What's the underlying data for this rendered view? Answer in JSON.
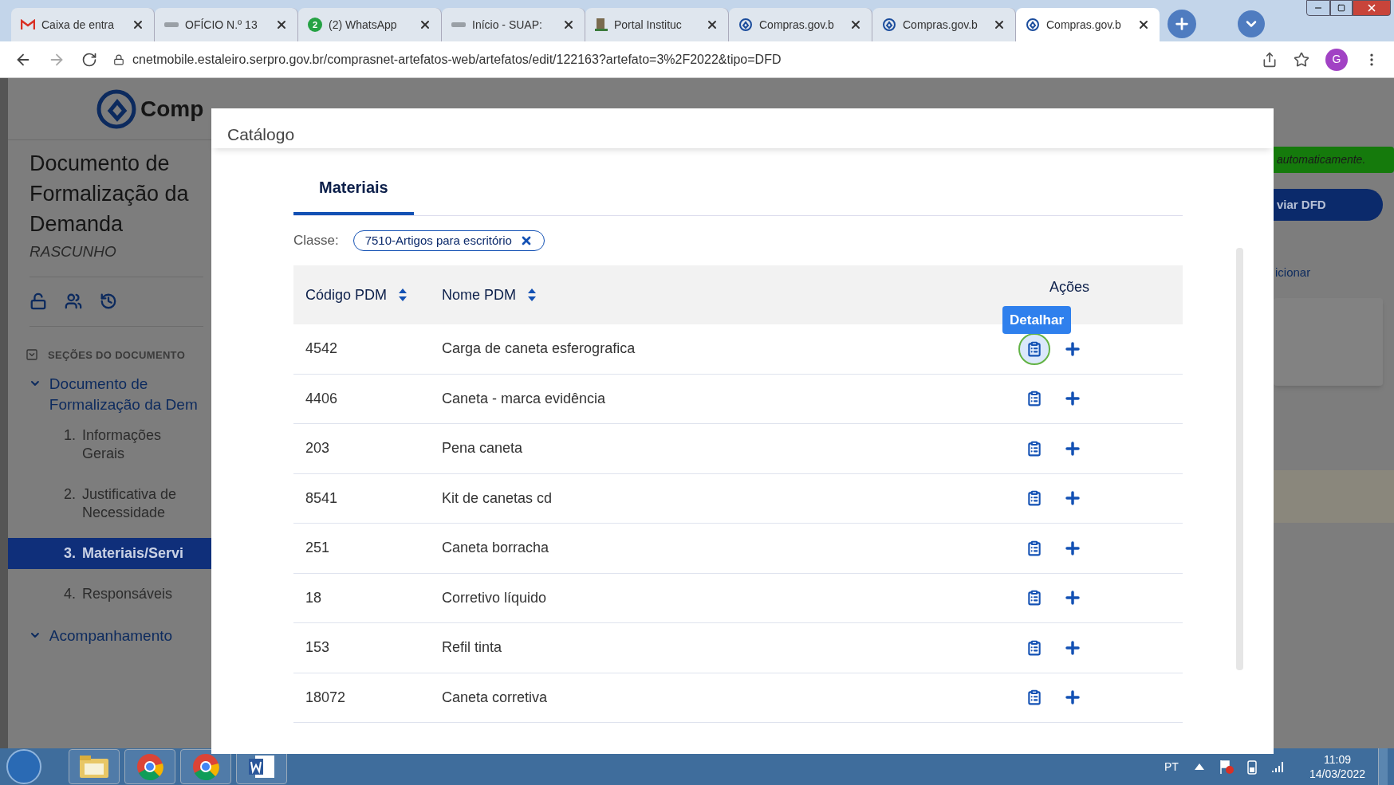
{
  "browser": {
    "tabs": [
      {
        "kind": "gmail",
        "title": "Caixa de entra",
        "selected": false
      },
      {
        "kind": "suap",
        "title": "OFÍCIO N.º 13",
        "selected": false
      },
      {
        "kind": "whatsapp",
        "badge": "2",
        "title": "(2) WhatsApp",
        "selected": false
      },
      {
        "kind": "suap",
        "title": "Início - SUAP:",
        "selected": false
      },
      {
        "kind": "portal",
        "title": "Portal Instituc",
        "selected": false
      },
      {
        "kind": "compras",
        "title": "Compras.gov.b",
        "selected": false
      },
      {
        "kind": "compras",
        "title": "Compras.gov.b",
        "selected": false
      },
      {
        "kind": "compras",
        "title": "Compras.gov.b",
        "selected": true
      }
    ],
    "url": "cnetmobile.estaleiro.serpro.gov.br/comprasnet-artefatos-web/artefatos/edit/122163?artefato=3%2F2022&tipo=DFD",
    "profile": "G"
  },
  "page": {
    "logo_text": "Comp",
    "document_title": "Documento de Formalização da Demanda",
    "status": "RASCUNHO",
    "sections_title": "SEÇÕES DO DOCUMENTO",
    "nav": [
      {
        "label": "Documento de Formalização da Dem",
        "expanded": true,
        "children": [
          {
            "number": "1.",
            "label": "Informações Gerais",
            "selected": false
          },
          {
            "number": "2.",
            "label": "Justificativa de Necessidade",
            "selected": false
          },
          {
            "number": "3.",
            "label": "Materiais/Servi",
            "selected": true
          },
          {
            "number": "4.",
            "label": "Responsáveis",
            "selected": false
          }
        ]
      },
      {
        "label": "Acompanhamento",
        "expanded": true
      }
    ],
    "save_notice": "automaticamente.",
    "send_button": "viar DFD",
    "add_link": "icionar"
  },
  "modal": {
    "title": "Catálogo",
    "tabs": [
      {
        "label": "Materiais",
        "selected": true
      }
    ],
    "filter": {
      "label": "Classe:",
      "chip": "7510-Artigos para escritório"
    },
    "columns": [
      {
        "label": "Código PDM",
        "sortable": true
      },
      {
        "label": "Nome PDM",
        "sortable": true
      },
      {
        "label": "Ações",
        "sortable": false
      }
    ],
    "tooltip": "Detalhar",
    "rows": [
      {
        "code": "4542",
        "name": "Carga de caneta esferografica",
        "hovered": true
      },
      {
        "code": "4406",
        "name": "Caneta - marca evidência",
        "hovered": false
      },
      {
        "code": "203",
        "name": "Pena caneta",
        "hovered": false
      },
      {
        "code": "8541",
        "name": "Kit de canetas cd",
        "hovered": false
      },
      {
        "code": "251",
        "name": "Caneta borracha",
        "hovered": false
      },
      {
        "code": "18",
        "name": "Corretivo líquido",
        "hovered": false
      },
      {
        "code": "153",
        "name": "Refil tinta",
        "hovered": false
      },
      {
        "code": "18072",
        "name": "Caneta corretiva",
        "hovered": false
      }
    ]
  },
  "taskbar": {
    "apps": [
      {
        "kind": "explorer"
      },
      {
        "kind": "chrome"
      },
      {
        "kind": "chrome"
      },
      {
        "kind": "word"
      }
    ],
    "language": "PT",
    "time": "11:09",
    "date": "14/03/2022"
  }
}
